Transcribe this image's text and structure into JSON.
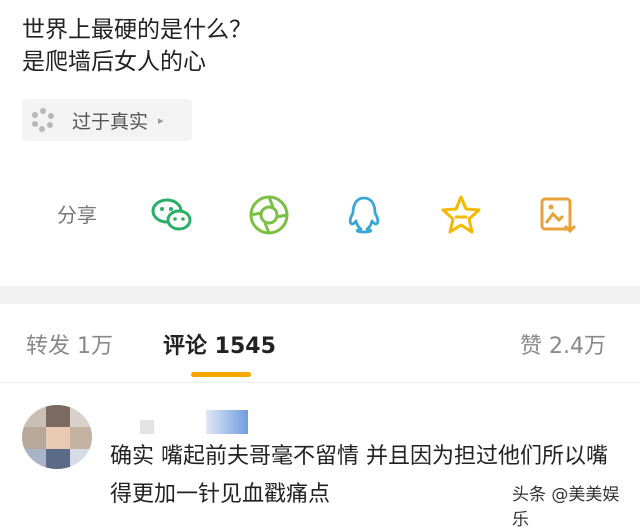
{
  "post": {
    "line1": "世界上最硬的是什么？",
    "line2": "是爬墙后女人的心"
  },
  "topic": {
    "label": "过于真实",
    "arrow": "▸"
  },
  "share": {
    "label": "分享",
    "items": [
      {
        "name": "wechat-icon",
        "color": "#2bae67"
      },
      {
        "name": "moments-icon",
        "color": "#7cc043"
      },
      {
        "name": "qq-icon",
        "color": "#3aa6d8"
      },
      {
        "name": "favorite-star-icon",
        "color": "#f5b800"
      },
      {
        "name": "save-image-icon",
        "color": "#e8a23a"
      }
    ]
  },
  "tabs": {
    "repost": "转发 1万",
    "comments": "评论 1545",
    "likes": "赞 2.4万"
  },
  "comment": {
    "text": "确实 嘴起前夫哥毫不留情 并且因为担过他们所以嘴得更加一针见血戳痛点"
  },
  "watermark": "头条 @美美娱乐",
  "colors": {
    "accent": "#f7a600"
  }
}
